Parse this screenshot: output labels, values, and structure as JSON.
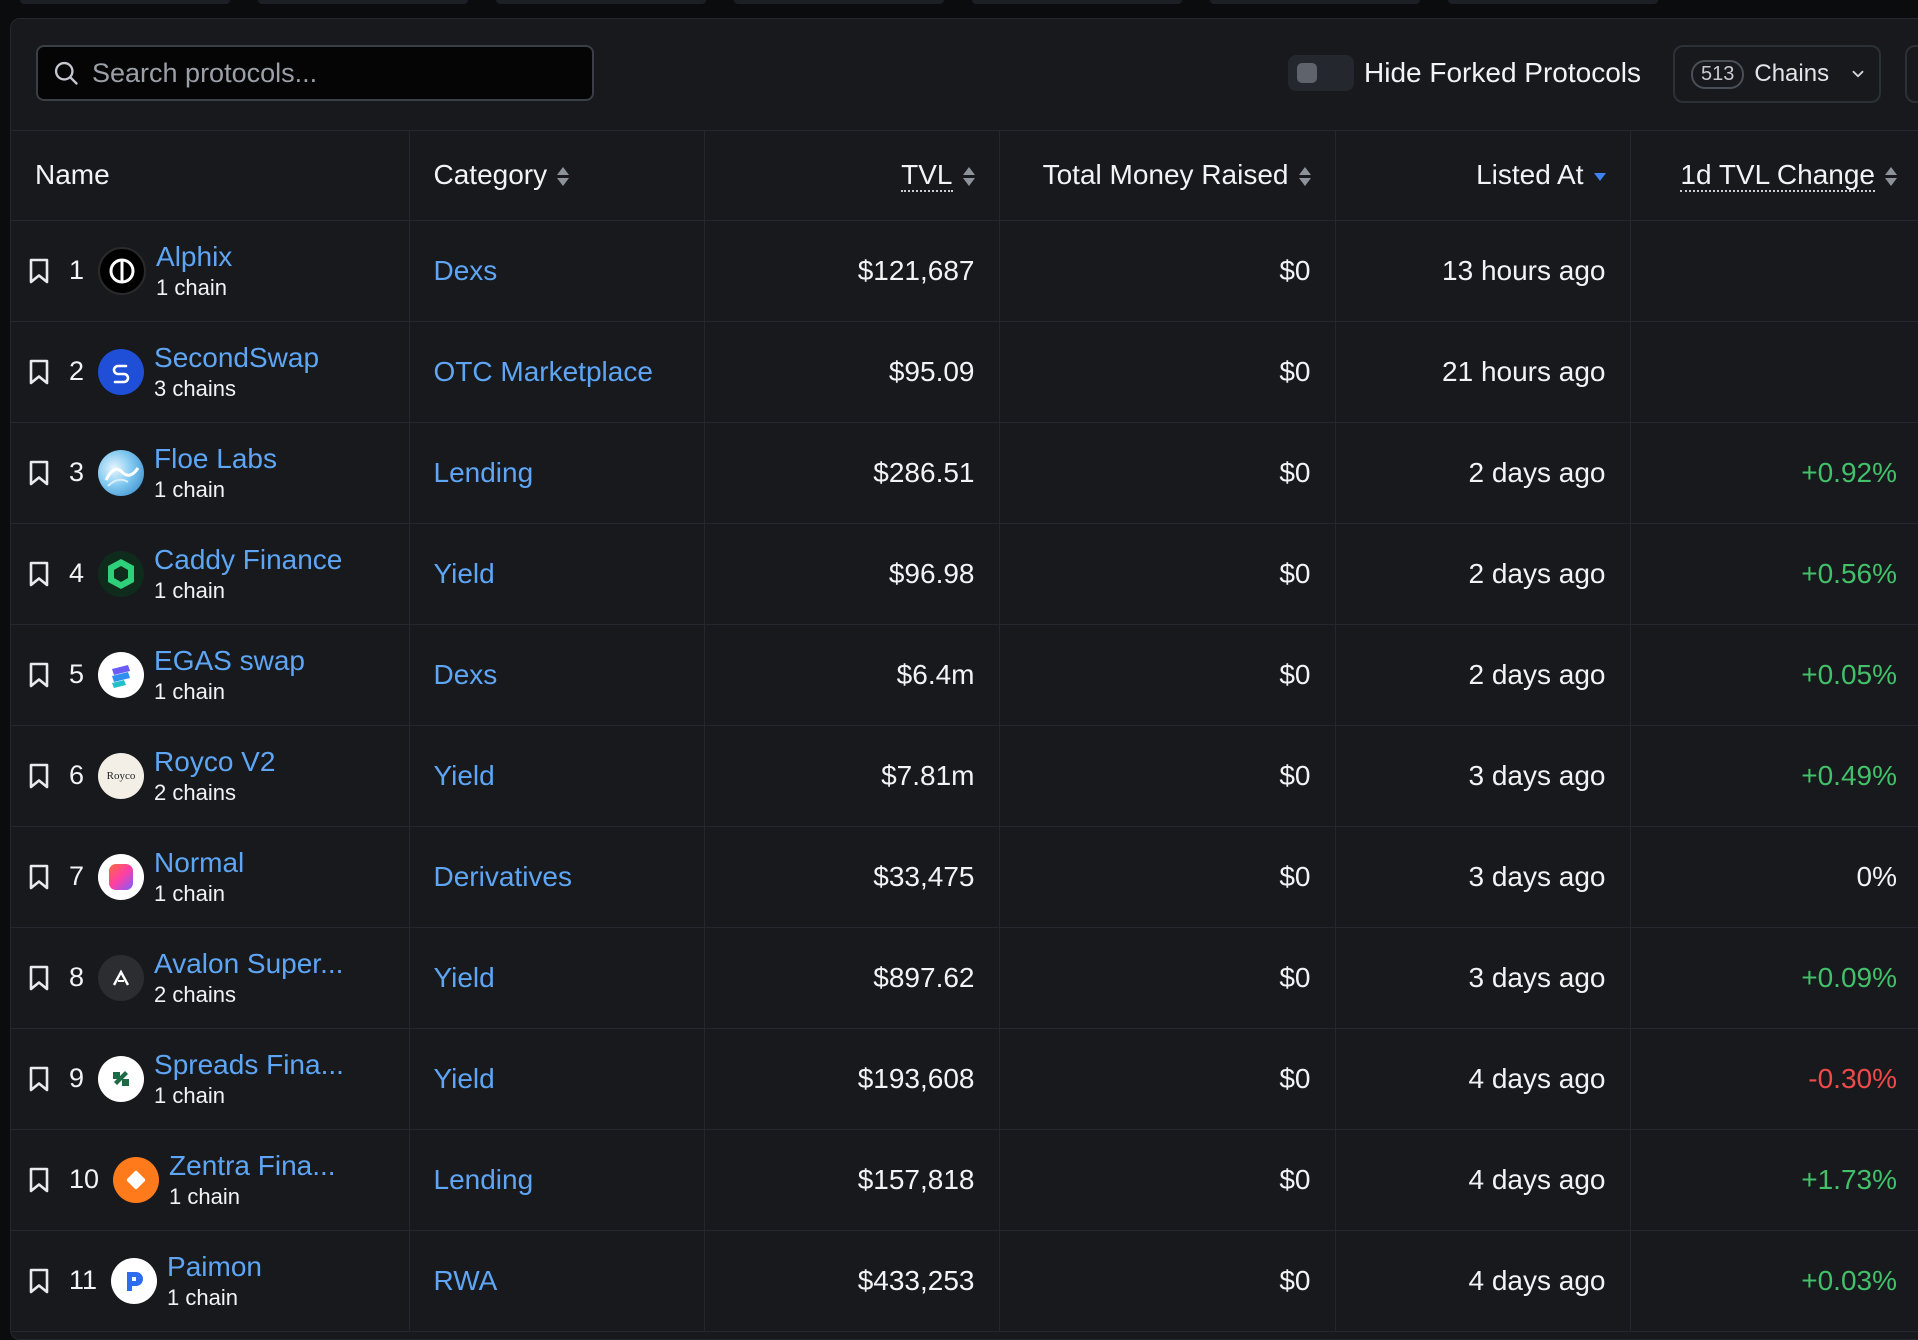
{
  "search": {
    "placeholder": "Search protocols..."
  },
  "toggle": {
    "label": "Hide Forked Protocols",
    "on": false
  },
  "chains_filter": {
    "count": "513",
    "label": "Chains"
  },
  "columns": {
    "name": "Name",
    "category": "Category",
    "tvl": "TVL",
    "raised": "Total Money Raised",
    "listed": "Listed At",
    "change": "1d TVL Change"
  },
  "colors": {
    "link": "#5ea6f5",
    "positive": "#42c06a",
    "negative": "#ef4a4a",
    "sort_active": "#3d82f0"
  },
  "rows": [
    {
      "rank": "1",
      "name": "Alphix",
      "chains": "1 chain",
      "category": "Dexs",
      "tvl": "$121,687",
      "raised": "$0",
      "listed": "13 hours ago",
      "change": "",
      "trend": "neu",
      "logo_icon": "alphix-logo-icon"
    },
    {
      "rank": "2",
      "name": "SecondSwap",
      "chains": "3 chains",
      "category": "OTC Marketplace",
      "tvl": "$95.09",
      "raised": "$0",
      "listed": "21 hours ago",
      "change": "",
      "trend": "neu",
      "logo_icon": "secondswap-logo-icon"
    },
    {
      "rank": "3",
      "name": "Floe Labs",
      "chains": "1 chain",
      "category": "Lending",
      "tvl": "$286.51",
      "raised": "$0",
      "listed": "2 days ago",
      "change": "+0.92%",
      "trend": "pos",
      "logo_icon": "floe-labs-logo-icon"
    },
    {
      "rank": "4",
      "name": "Caddy Finance",
      "chains": "1 chain",
      "category": "Yield",
      "tvl": "$96.98",
      "raised": "$0",
      "listed": "2 days ago",
      "change": "+0.56%",
      "trend": "pos",
      "logo_icon": "caddy-finance-logo-icon"
    },
    {
      "rank": "5",
      "name": "EGAS swap",
      "chains": "1 chain",
      "category": "Dexs",
      "tvl": "$6.4m",
      "raised": "$0",
      "listed": "2 days ago",
      "change": "+0.05%",
      "trend": "pos",
      "logo_icon": "egas-swap-logo-icon"
    },
    {
      "rank": "6",
      "name": "Royco V2",
      "chains": "2 chains",
      "category": "Yield",
      "tvl": "$7.81m",
      "raised": "$0",
      "listed": "3 days ago",
      "change": "+0.49%",
      "trend": "pos",
      "logo_icon": "royco-logo-icon",
      "logo_text": "Royco"
    },
    {
      "rank": "7",
      "name": "Normal",
      "chains": "1 chain",
      "category": "Derivatives",
      "tvl": "$33,475",
      "raised": "$0",
      "listed": "3 days ago",
      "change": "0%",
      "trend": "neu",
      "logo_icon": "normal-logo-icon"
    },
    {
      "rank": "8",
      "name": "Avalon Super...",
      "chains": "2 chains",
      "category": "Yield",
      "tvl": "$897.62",
      "raised": "$0",
      "listed": "3 days ago",
      "change": "+0.09%",
      "trend": "pos",
      "logo_icon": "avalon-logo-icon"
    },
    {
      "rank": "9",
      "name": "Spreads Fina...",
      "chains": "1 chain",
      "category": "Yield",
      "tvl": "$193,608",
      "raised": "$0",
      "listed": "4 days ago",
      "change": "-0.30%",
      "trend": "neg",
      "logo_icon": "spreads-logo-icon"
    },
    {
      "rank": "10",
      "name": "Zentra Fina...",
      "chains": "1 chain",
      "category": "Lending",
      "tvl": "$157,818",
      "raised": "$0",
      "listed": "4 days ago",
      "change": "+1.73%",
      "trend": "pos",
      "logo_icon": "zentra-logo-icon"
    },
    {
      "rank": "11",
      "name": "Paimon",
      "chains": "1 chain",
      "category": "RWA",
      "tvl": "$433,253",
      "raised": "$0",
      "listed": "4 days ago",
      "change": "+0.03%",
      "trend": "pos",
      "logo_icon": "paimon-logo-icon"
    }
  ]
}
